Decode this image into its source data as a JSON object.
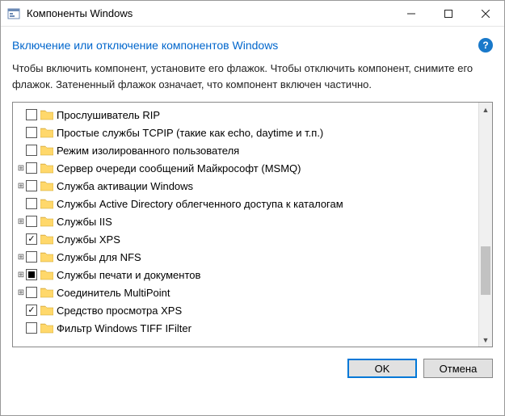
{
  "window": {
    "title": "Компоненты Windows"
  },
  "heading": "Включение или отключение компонентов Windows",
  "help_symbol": "?",
  "description": "Чтобы включить компонент, установите его флажок. Чтобы отключить компонент, снимите его флажок. Затененный флажок означает, что компонент включен частично.",
  "items": [
    {
      "label": "Прослушиватель RIP",
      "state": "unchecked",
      "expandable": false
    },
    {
      "label": "Простые службы TCPIP (такие как echo, daytime и т.п.)",
      "state": "unchecked",
      "expandable": false
    },
    {
      "label": "Режим изолированного пользователя",
      "state": "unchecked",
      "expandable": false
    },
    {
      "label": "Сервер очереди сообщений Майкрософт (MSMQ)",
      "state": "unchecked",
      "expandable": true
    },
    {
      "label": "Служба активации Windows",
      "state": "unchecked",
      "expandable": true
    },
    {
      "label": "Службы Active Directory облегченного доступа к каталогам",
      "state": "unchecked",
      "expandable": false
    },
    {
      "label": "Службы IIS",
      "state": "unchecked",
      "expandable": true
    },
    {
      "label": "Службы XPS",
      "state": "checked",
      "expandable": false
    },
    {
      "label": "Службы для NFS",
      "state": "unchecked",
      "expandable": true
    },
    {
      "label": "Службы печати и документов",
      "state": "partial",
      "expandable": true
    },
    {
      "label": "Соединитель MultiPoint",
      "state": "unchecked",
      "expandable": true
    },
    {
      "label": "Средство просмотра XPS",
      "state": "checked",
      "expandable": false
    },
    {
      "label": "Фильтр Windows TIFF IFilter",
      "state": "unchecked",
      "expandable": false
    }
  ],
  "buttons": {
    "ok": "OK",
    "cancel": "Отмена"
  }
}
